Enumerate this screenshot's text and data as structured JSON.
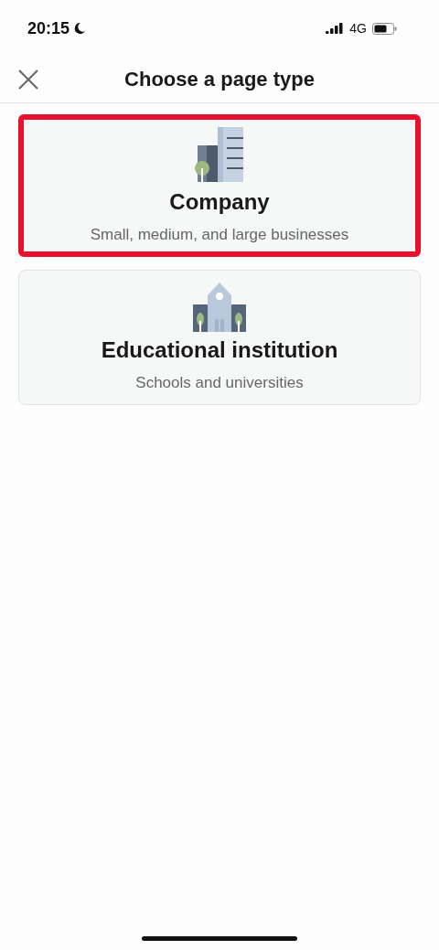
{
  "status_bar": {
    "time": "20:15",
    "network": "4G"
  },
  "header": {
    "title": "Choose a page type"
  },
  "options": [
    {
      "kind": "company",
      "title": "Company",
      "subtitle": "Small, medium, and large businesses",
      "highlighted": true
    },
    {
      "kind": "school",
      "title": "Educational institution",
      "subtitle": "Schools and universities",
      "highlighted": false
    }
  ]
}
